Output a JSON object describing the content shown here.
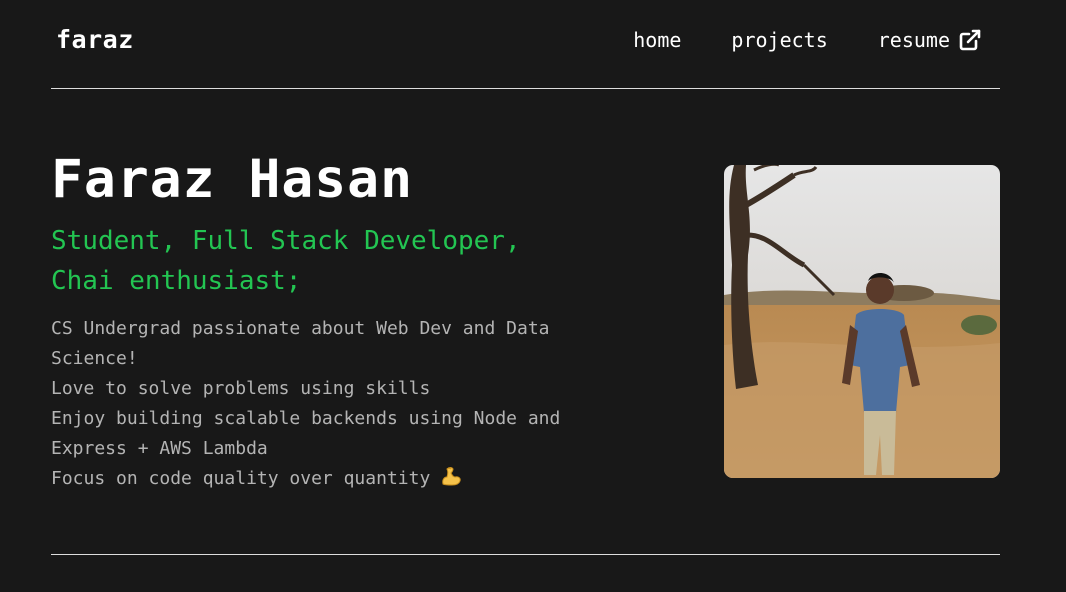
{
  "header": {
    "logo": "faraz",
    "nav": [
      {
        "label": "home"
      },
      {
        "label": "projects"
      },
      {
        "label": "resume",
        "icon": "external-link-icon"
      }
    ]
  },
  "hero": {
    "name": "Faraz Hasan",
    "tagline_line1": "Student, Full Stack Developer,",
    "tagline_line2": "Chai enthusiast;",
    "bio": [
      "CS Undergrad passionate about Web Dev and Data",
      "Science!",
      "Love to solve problems using skills",
      "Enjoy building scalable backends using Node and",
      "Express + AWS Lambda",
      "Focus on code quality over quantity"
    ],
    "bio_trailing_icon": "flexed-biceps-icon"
  },
  "colors": {
    "background": "#181818",
    "accent": "#23c552",
    "text_muted": "#b4b4b4"
  }
}
